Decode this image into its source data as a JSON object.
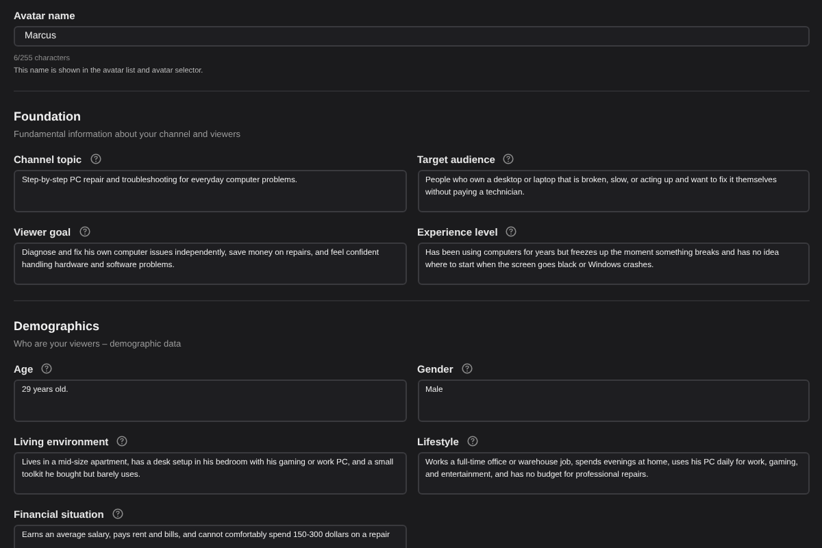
{
  "avatar_name": {
    "label": "Avatar name",
    "value": "Marcus",
    "counter": "6/255 characters",
    "help": "This name is shown in the avatar list and avatar selector."
  },
  "sections": [
    {
      "title": "Foundation",
      "subtitle": "Fundamental information about your channel and viewers",
      "fields": [
        {
          "label": "Channel topic",
          "value": "Step-by-step PC repair and troubleshooting for everyday computer problems."
        },
        {
          "label": "Target audience",
          "value": "People who own a desktop or laptop that is broken, slow, or acting up and want to fix it themselves without paying a technician."
        },
        {
          "label": "Viewer goal",
          "value": "Diagnose and fix his own computer issues independently, save money on repairs, and feel confident handling hardware and software problems."
        },
        {
          "label": "Experience level",
          "value": "Has been using computers for years but freezes up the moment something breaks and has no idea where to start when the screen goes black or Windows crashes."
        }
      ]
    },
    {
      "title": "Demographics",
      "subtitle": "Who are your viewers – demographic data",
      "fields": [
        {
          "label": "Age",
          "value": "29 years old."
        },
        {
          "label": "Gender",
          "value": "Male"
        },
        {
          "label": "Living environment",
          "value": "Lives in a mid-size apartment, has a desk setup in his bedroom with his gaming or work PC, and a small toolkit he bought but barely uses."
        },
        {
          "label": "Lifestyle",
          "value": "Works a full-time office or warehouse job, spends evenings at home, uses his PC daily for work, gaming, and entertainment, and has no budget for professional repairs."
        },
        {
          "label": "Financial situation",
          "value": "Earns an average salary, pays rent and bills, and cannot comfortably spend 150-300 dollars on a repair"
        }
      ]
    }
  ]
}
